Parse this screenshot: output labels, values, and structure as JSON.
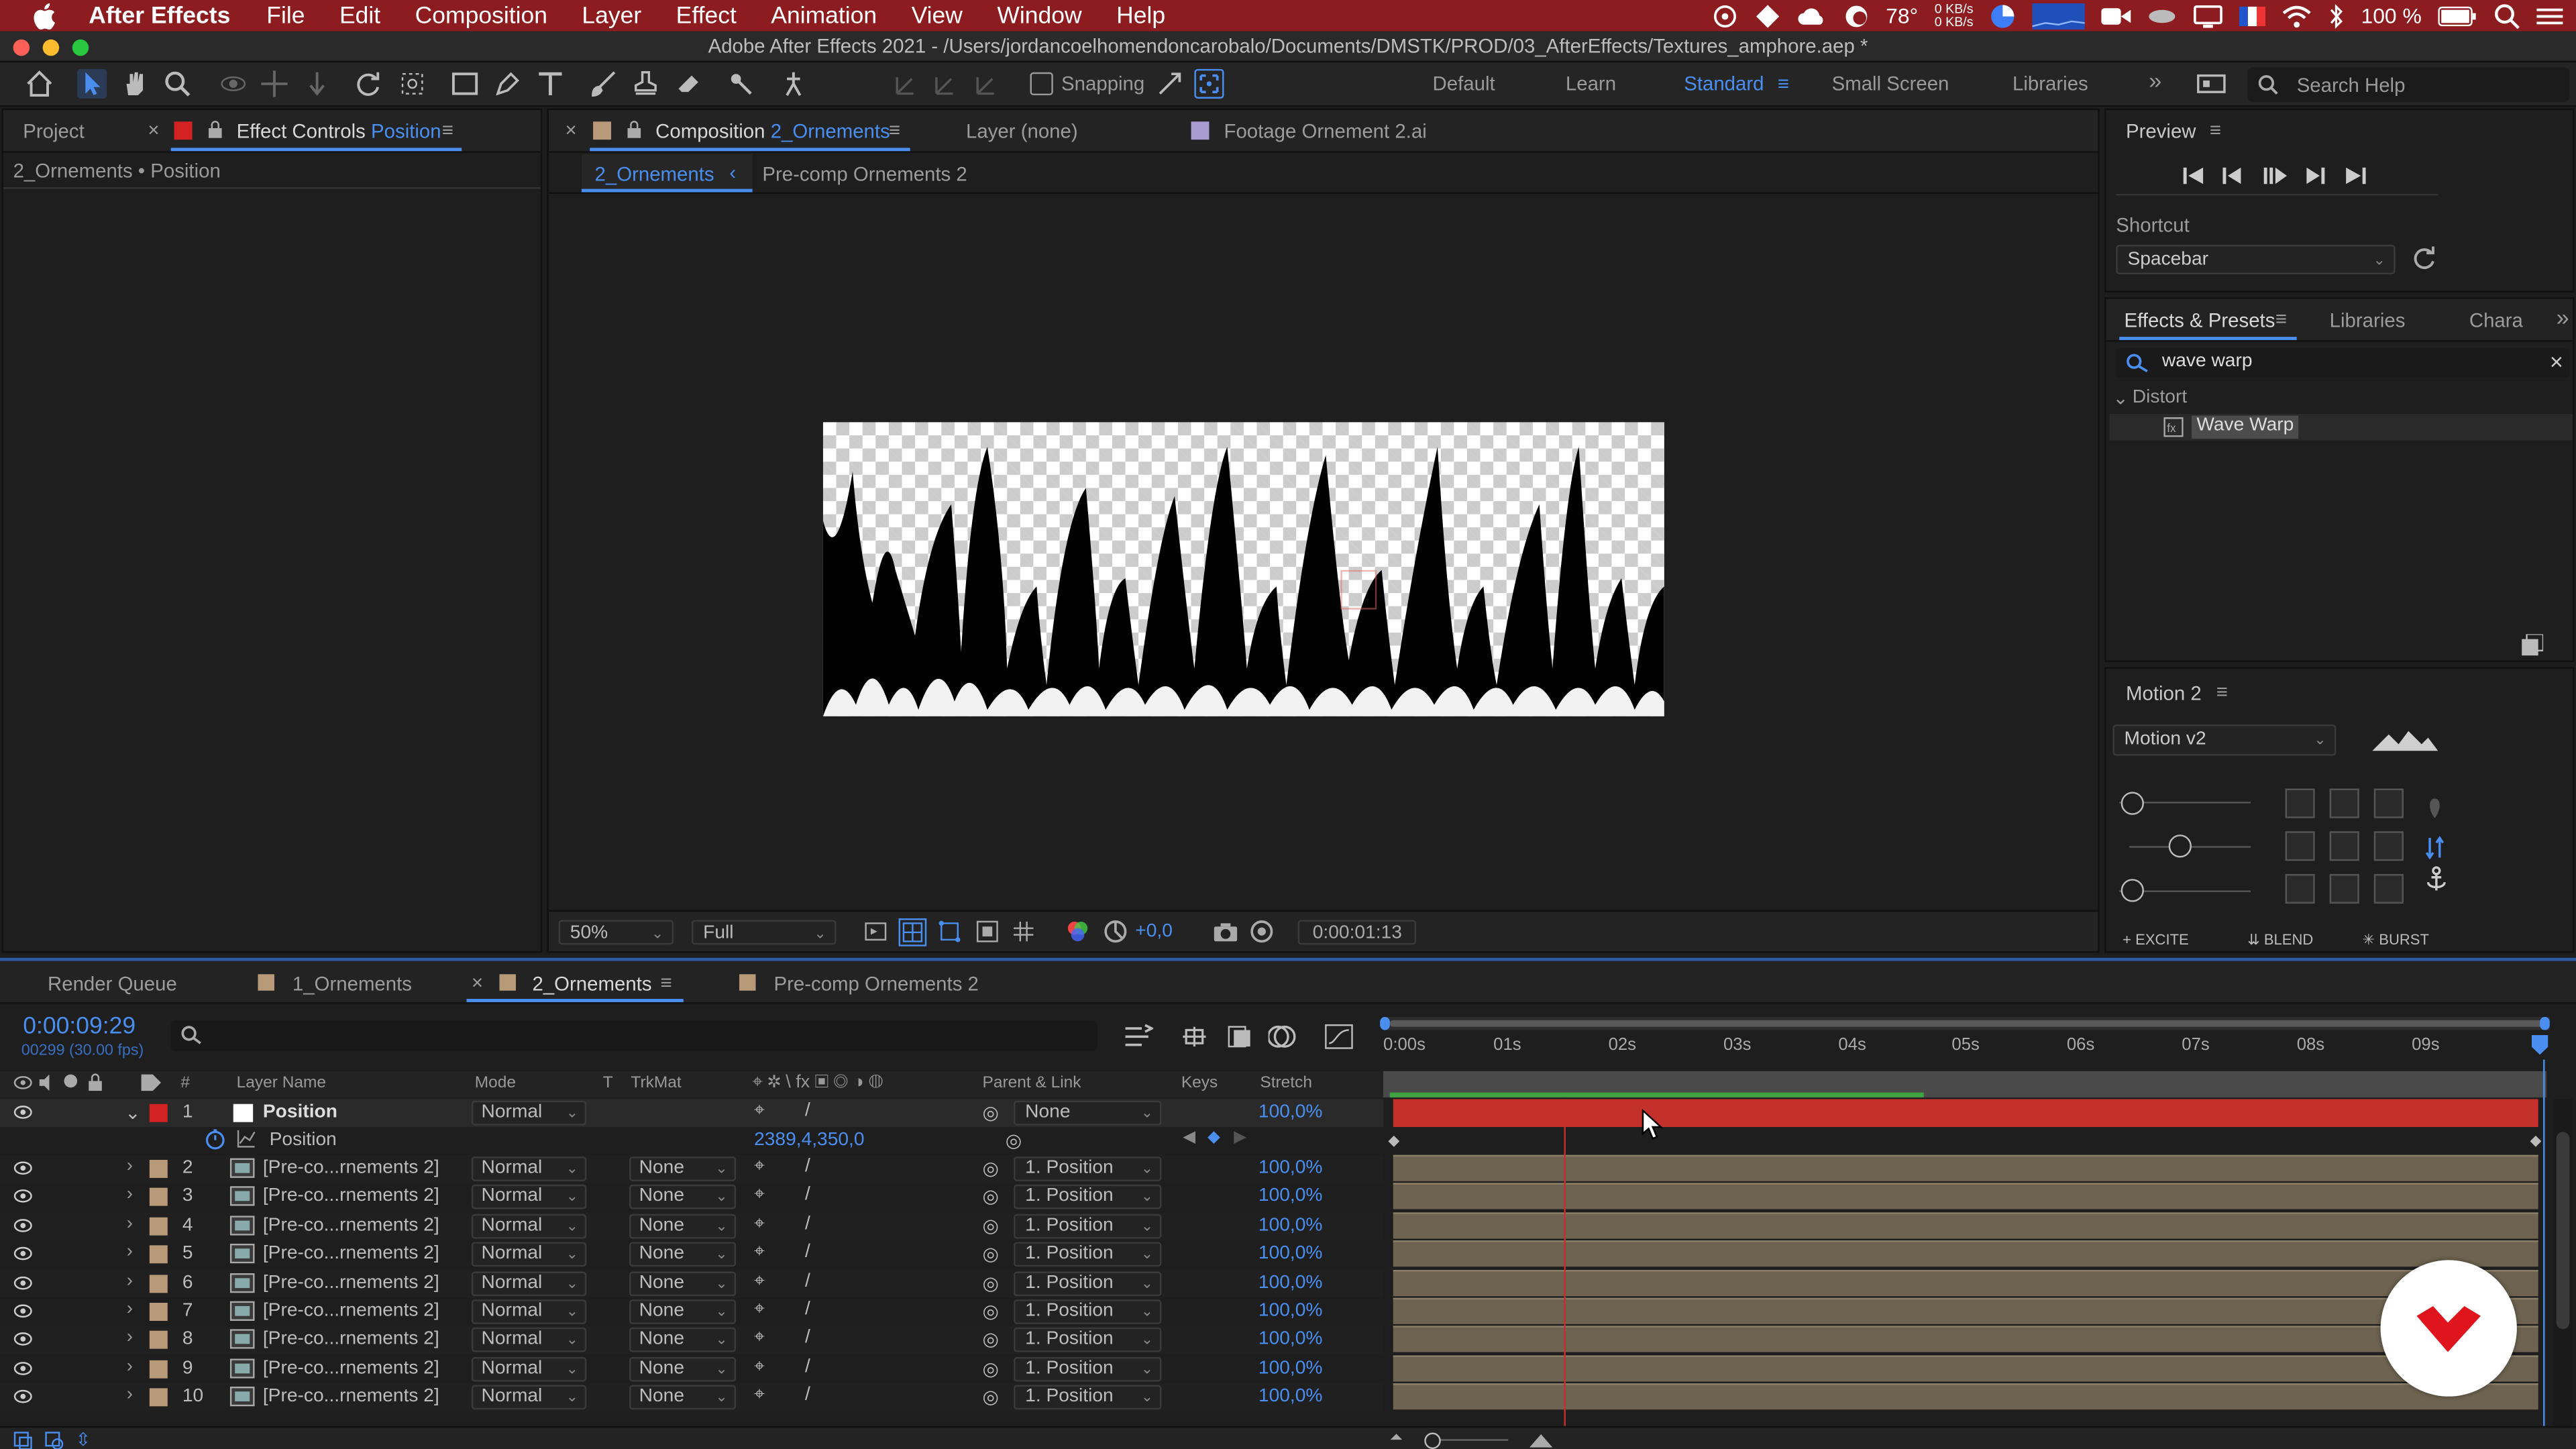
{
  "menubar": {
    "app_name": "After Effects",
    "items": [
      "File",
      "Edit",
      "Composition",
      "Layer",
      "Effect",
      "Animation",
      "View",
      "Window",
      "Help"
    ],
    "temp": "78°",
    "net_up": "0 KB/s",
    "net_down": "0 KB/s",
    "battery": "100 %"
  },
  "window_title": "Adobe After Effects 2021 - /Users/jordancoelhomendoncarobalo/Documents/DMSTK/PROD/03_AfterEffects/Textures_amphore.aep *",
  "toolbar": {
    "snapping": "Snapping",
    "workspaces": [
      "Default",
      "Learn",
      "Standard",
      "Small Screen",
      "Libraries"
    ],
    "active_workspace": "Standard",
    "search_placeholder": "Search Help"
  },
  "left_panel": {
    "tab_project": "Project",
    "tab_effect_controls": "Effect Controls",
    "tab_effect_controls_target": "Position",
    "breadcrumb": "2_Ornements • Position"
  },
  "comp_panel": {
    "tab_comp_prefix": "Composition",
    "tab_comp_name": "2_Ornements",
    "tab_layer": "Layer (none)",
    "tab_footage": "Footage Ornement 2.ai",
    "crumb_active": "2_Ornements",
    "crumb_next": "Pre-comp Ornements 2",
    "zoom": "50%",
    "resolution": "Full",
    "exposure": "+0,0",
    "timecode": "0:00:01:13"
  },
  "preview_panel": {
    "title": "Preview",
    "shortcut_label": "Shortcut",
    "shortcut_value": "Spacebar"
  },
  "effects_panel": {
    "tab_effects": "Effects & Presets",
    "tab_libraries": "Libraries",
    "tab_chara": "Chara",
    "search_value": "wave warp",
    "category": "Distort",
    "result": "Wave Warp"
  },
  "motion_panel": {
    "title": "Motion 2",
    "version": "Motion v2",
    "btn_excite": "EXCITE",
    "btn_blend": "BLEND",
    "btn_burst": "BURST"
  },
  "timeline": {
    "tab_render": "Render Queue",
    "tab_1": "1_Ornements",
    "tab_2": "2_Ornements",
    "tab_3": "Pre-comp Ornements 2",
    "timecode": "0:00:09:29",
    "frame_info": "00299 (30.00 fps)",
    "columns": {
      "num": "#",
      "layer_name": "Layer Name",
      "mode": "Mode",
      "t": "T",
      "trkmat": "TrkMat",
      "parent": "Parent & Link",
      "keys": "Keys",
      "stretch": "Stretch"
    },
    "ruler": [
      "0:00s",
      "01s",
      "02s",
      "03s",
      "04s",
      "05s",
      "06s",
      "07s",
      "08s",
      "09s"
    ],
    "layer1": {
      "num": "1",
      "name": "Position",
      "mode": "Normal",
      "parent": "None",
      "stretch": "100,0%"
    },
    "layer1_prop": {
      "name": "Position",
      "value": "2389,4,350,0"
    },
    "layers": [
      {
        "num": "2",
        "name": "[Pre-co...rnements 2]",
        "mode": "Normal",
        "trkmat": "None",
        "parent": "1. Position",
        "stretch": "100,0%"
      },
      {
        "num": "3",
        "name": "[Pre-co...rnements 2]",
        "mode": "Normal",
        "trkmat": "None",
        "parent": "1. Position",
        "stretch": "100,0%"
      },
      {
        "num": "4",
        "name": "[Pre-co...rnements 2]",
        "mode": "Normal",
        "trkmat": "None",
        "parent": "1. Position",
        "stretch": "100,0%"
      },
      {
        "num": "5",
        "name": "[Pre-co...rnements 2]",
        "mode": "Normal",
        "trkmat": "None",
        "parent": "1. Position",
        "stretch": "100,0%"
      },
      {
        "num": "6",
        "name": "[Pre-co...rnements 2]",
        "mode": "Normal",
        "trkmat": "None",
        "parent": "1. Position",
        "stretch": "100,0%"
      },
      {
        "num": "7",
        "name": "[Pre-co...rnements 2]",
        "mode": "Normal",
        "trkmat": "None",
        "parent": "1. Position",
        "stretch": "100,0%"
      },
      {
        "num": "8",
        "name": "[Pre-co...rnements 2]",
        "mode": "Normal",
        "trkmat": "None",
        "parent": "1. Position",
        "stretch": "100,0%"
      },
      {
        "num": "9",
        "name": "[Pre-co...rnements 2]",
        "mode": "Normal",
        "trkmat": "None",
        "parent": "1. Position",
        "stretch": "100,0%"
      },
      {
        "num": "10",
        "name": "[Pre-co...rnements 2]",
        "mode": "Normal",
        "trkmat": "None",
        "parent": "1. Position",
        "stretch": "100,0%"
      }
    ]
  },
  "colors": {
    "accent": "#4a8ef0",
    "layer_red": "#c4302b",
    "bar_tan": "#6e6350",
    "menubar": "#8c1c1f"
  }
}
